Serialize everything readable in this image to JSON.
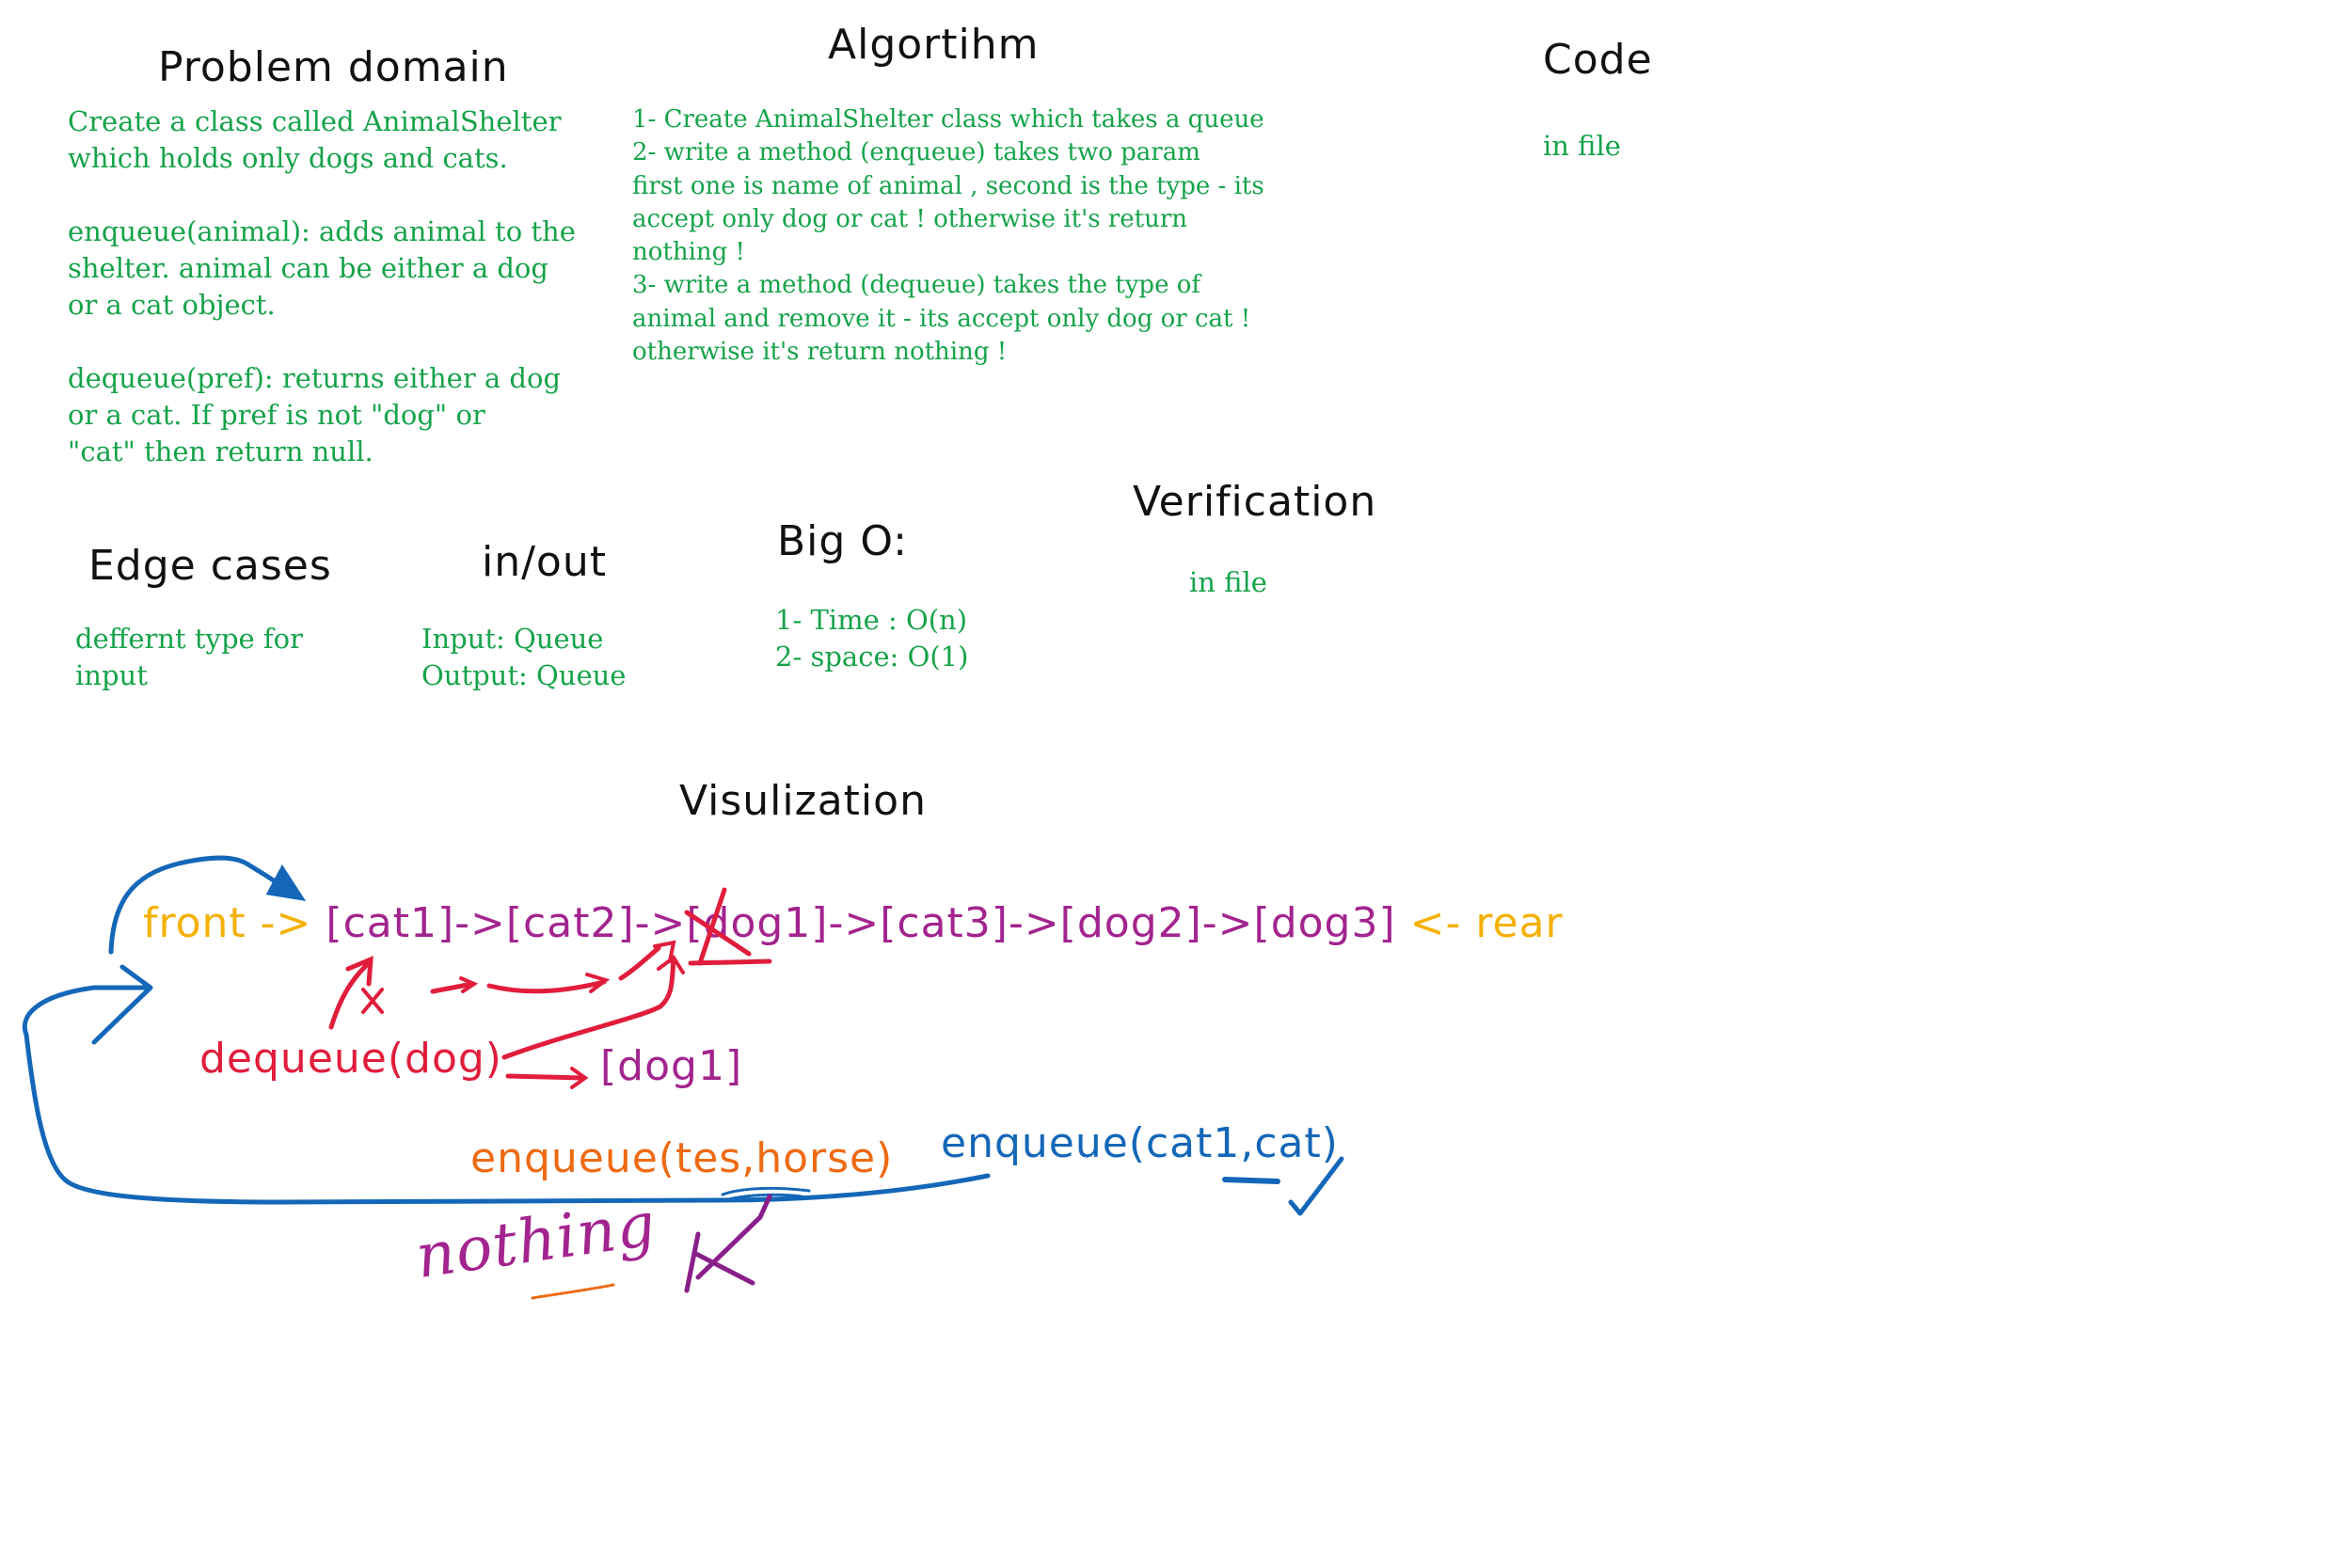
{
  "problem_domain": {
    "heading": "Problem domain",
    "lines": [
      "Create a class called AnimalShelter",
      "which holds only dogs and cats.",
      "",
      "enqueue(animal): adds animal to the",
      "shelter. animal can be either a dog",
      "or a cat object.",
      "",
      "dequeue(pref): returns either a dog",
      "or a cat. If pref is not \"dog\" or",
      "\"cat\" then return null."
    ]
  },
  "algorithm": {
    "heading": "Algortihm",
    "lines": [
      "1- Create AnimalShelter class which takes a queue",
      "2- write a method (enqueue) takes two param",
      "first one is name of animal , second is the type - its",
      "accept only dog or cat ! otherwise it's return",
      "nothing !",
      "3- write a method (dequeue) takes the type of",
      "animal and remove it - its accept only dog or cat !",
      "otherwise it's return nothing !"
    ]
  },
  "code": {
    "heading": "Code",
    "text": "in file"
  },
  "verification": {
    "heading": "Verification",
    "text": "in file"
  },
  "edge_cases": {
    "heading": "Edge cases",
    "lines": [
      " deffernt type for",
      "input"
    ]
  },
  "in_out": {
    "heading": "in/out",
    "lines": [
      "Input: Queue",
      "Output: Queue"
    ]
  },
  "big_o": {
    "heading": "Big O:",
    "lines": [
      "1- Time : O(n)",
      "2- space: O(1)"
    ]
  },
  "visualization": {
    "heading": "Visulization",
    "front_label": "front ->",
    "queue": "[cat1]->[cat2]->[dog1]->[cat3]->[dog2]->[dog3]",
    "rear_label": "<- rear",
    "dequeue_call": "dequeue(dog)",
    "dequeue_result": "[dog1]",
    "enqueue_bad": "enqueue(tes,horse)",
    "enqueue_good": "enqueue(cat1,cat)",
    "nothing_label": "nothing"
  },
  "colors": {
    "heading": "#111111",
    "notes": "#16a34a",
    "front_rear": "#f5b000",
    "queue": "#a3248e",
    "dequeue": "#e11d3c",
    "enqueue_good": "#1467b8",
    "enqueue_bad": "#ee6a12"
  }
}
